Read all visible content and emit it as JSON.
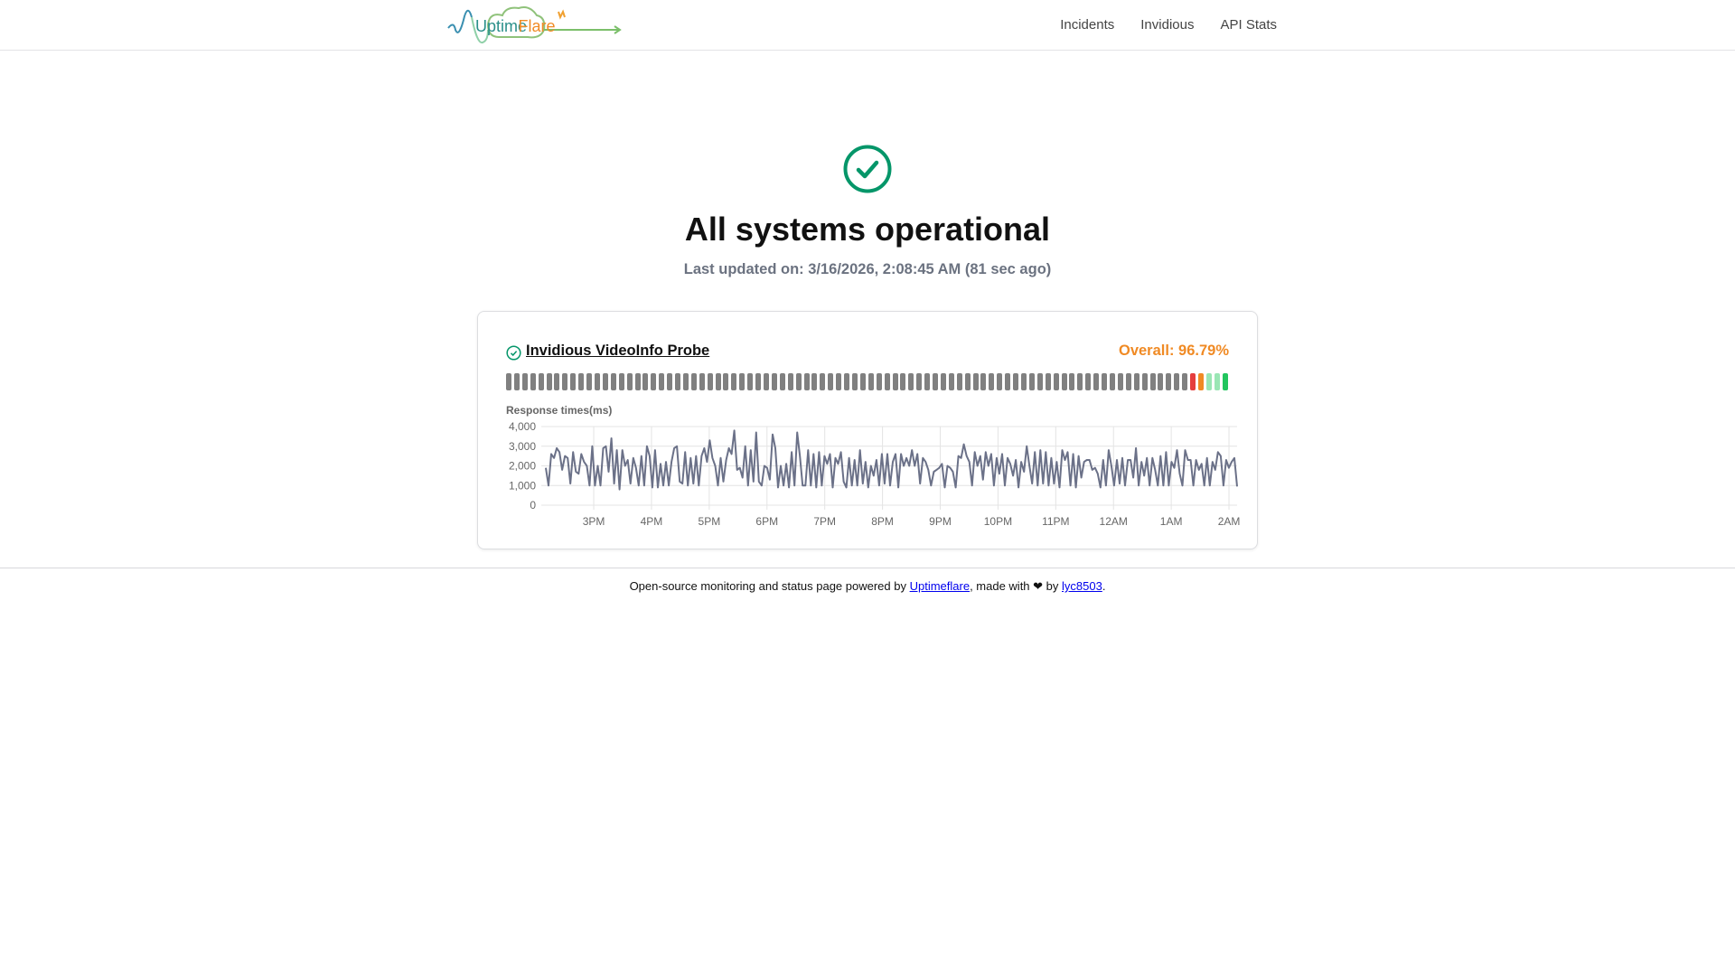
{
  "header": {
    "logo_text": "UptimeFlare",
    "nav": [
      {
        "label": "Incidents"
      },
      {
        "label": "Invidious"
      },
      {
        "label": "API Stats"
      }
    ]
  },
  "status": {
    "icon": "check-circle-icon",
    "title": "All systems operational",
    "last_updated": "Last updated on: 3/16/2026, 2:08:45 AM (81 sec ago)",
    "color": "#059669"
  },
  "monitor": {
    "name": "Invidious VideoInfo Probe",
    "overall": "Overall: 96.79%",
    "bar_groups": [
      {
        "status": "nodata",
        "count": 85,
        "color": "#808080"
      },
      {
        "status": "down",
        "count": 1,
        "color": "#e53e3e"
      },
      {
        "status": "degraded",
        "count": 1,
        "color": "#f08a24"
      },
      {
        "status": "partial",
        "count": 2,
        "color": "#9ae6b4"
      },
      {
        "status": "up",
        "count": 1,
        "color": "#22c55e"
      }
    ],
    "chart_title": "Response times(ms)"
  },
  "chart_data": {
    "type": "line",
    "title": "Response times(ms)",
    "ylim": [
      0,
      4000
    ],
    "yticks": [
      "4,000",
      "3,000",
      "2,000",
      "1,000",
      "0"
    ],
    "ytick_values": [
      4000,
      3000,
      2000,
      1000,
      0
    ],
    "xticks": [
      "3PM",
      "4PM",
      "5PM",
      "6PM",
      "7PM",
      "8PM",
      "9PM",
      "10PM",
      "11PM",
      "12AM",
      "1AM",
      "2AM"
    ],
    "x_start_hour": 14.17,
    "x_end_hour": 26.14,
    "series_color": "#6b7188",
    "values": [
      1900,
      1000,
      2600,
      2400,
      2900,
      2700,
      1800,
      2500,
      2400,
      1100,
      2700,
      1700,
      1600,
      2600,
      2200,
      2000,
      1000,
      3000,
      1000,
      2000,
      1000,
      2900,
      3000,
      1700,
      3400,
      1100,
      2800,
      800,
      2800,
      2000,
      2300,
      1100,
      2400,
      1900,
      1000,
      2500,
      1000,
      3000,
      2500,
      900,
      2800,
      900,
      2100,
      1000,
      2200,
      1000,
      2200,
      2900,
      3000,
      1200,
      1100,
      2700,
      1000,
      2400,
      1100,
      2500,
      1000,
      2500,
      2900,
      2200,
      3300,
      2400,
      2000,
      1000,
      2400,
      1200,
      2300,
      2900,
      2600,
      3800,
      1800,
      1900,
      1400,
      3000,
      1000,
      2800,
      1200,
      3700,
      1200,
      1000,
      2000,
      1900,
      1300,
      3600,
      2900,
      900,
      2000,
      1000,
      2100,
      900,
      2700,
      1000,
      3700,
      2500,
      1000,
      1000,
      2800,
      1000,
      2600,
      900,
      2700,
      1000,
      2500,
      2100,
      2600,
      900,
      2400,
      2100,
      2700,
      1200,
      900,
      2400,
      1000,
      2300,
      1000,
      2800,
      1100,
      2200,
      900,
      2000,
      1500,
      2300,
      1000,
      2600,
      1100,
      2600,
      1000,
      2200,
      2600,
      900,
      2600,
      2000,
      2400,
      2000,
      2800,
      2000,
      2600,
      1100,
      2400,
      2200,
      1800,
      1000,
      1700,
      1800,
      1900,
      2100,
      900,
      2000,
      1900,
      1700,
      900,
      2500,
      2400,
      3100,
      2500,
      2200,
      1000,
      2700,
      2000,
      2500,
      1300,
      2700,
      2000,
      2600,
      1000,
      2400,
      1600,
      2600,
      1000,
      2400,
      2100,
      1500,
      2300,
      900,
      2200,
      1700,
      3000,
      2000,
      1100,
      2700,
      1000,
      2800,
      1100,
      2700,
      1000,
      2400,
      1100,
      2200,
      900,
      2800,
      2300,
      2700,
      1000,
      2600,
      900,
      2500,
      1400,
      2200,
      2300,
      2300,
      1800,
      1900,
      1600,
      900,
      2300,
      1000,
      2800,
      2000,
      1000,
      2300,
      1100,
      2400,
      1000,
      2300,
      2300,
      1400,
      2900,
      1000,
      2200,
      1500,
      2400,
      1000,
      2400,
      1800,
      1000,
      2500,
      1000,
      2700,
      1000,
      2200,
      1900,
      2800,
      1600,
      1000,
      2800,
      2300,
      2300,
      1000,
      2300,
      1800,
      2100,
      1000,
      2400,
      1000,
      2200,
      1800,
      2700,
      2500,
      1000,
      2300,
      1900,
      2200,
      2400,
      950
    ]
  },
  "footer": {
    "text_before": "Open-source monitoring and status page powered by ",
    "link1": "Uptimeflare",
    "text_mid": ", made with ❤ by ",
    "link2": "lyc8503",
    "text_after": "."
  }
}
